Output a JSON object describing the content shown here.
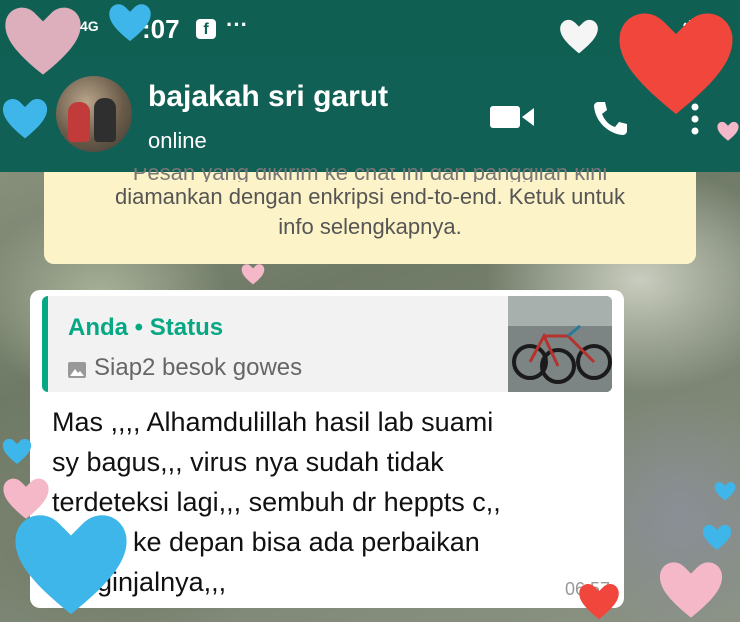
{
  "status_bar": {
    "network": "4G",
    "time": ":07",
    "more": "···"
  },
  "header": {
    "contact_name": "bajakah sri garut",
    "contact_status": "online",
    "icons": [
      "back-icon",
      "video-call-icon",
      "voice-call-icon",
      "more-menu-icon"
    ]
  },
  "encryption_notice": {
    "line1": "Pesan yang dikirim ke chat ini dan panggilan kini",
    "line2": "diamankan dengan enkripsi end-to-end. Ketuk untuk",
    "line3": "info selengkapnya."
  },
  "message": {
    "quote": {
      "author": "Anda • Status",
      "text": "Siap2 besok gowes",
      "icon": "photo-icon"
    },
    "lines": [
      "Mas ,,,, Alhamdulillah hasil lab suami",
      "sy bagus,,, virus nya sudah tidak",
      "terdeteksi lagi,,, sembuh dr heppts c,,",
      "s    ga ke depan bisa ada perbaikan",
      "   2 ginjalnya,,,"
    ],
    "time": "06.57"
  },
  "colors": {
    "header_bg": "#116056",
    "accent": "#06a884",
    "notice_bg": "#fcf4c8"
  }
}
